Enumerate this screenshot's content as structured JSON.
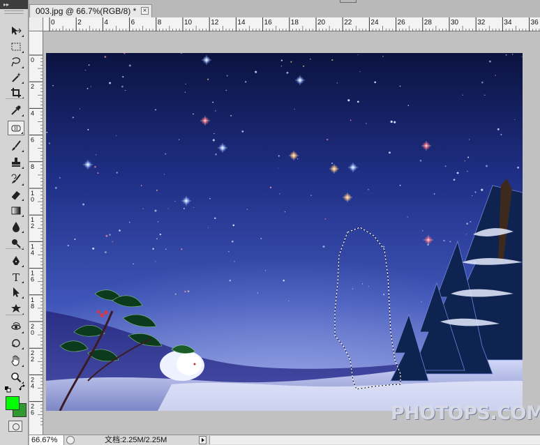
{
  "document": {
    "tab_title": "003.jpg @ 66.7%(RGB/8) *",
    "close_glyph": "×"
  },
  "toolbar": {
    "collapse_glyph": "▸▸",
    "tools": [
      {
        "name": "move-tool-icon"
      },
      {
        "name": "rectangular-marquee-tool-icon"
      },
      {
        "name": "lasso-tool-icon"
      },
      {
        "name": "magic-wand-tool-icon"
      },
      {
        "name": "crop-tool-icon"
      },
      {
        "name": "eyedropper-tool-icon"
      },
      {
        "name": "healing-brush-tool-icon"
      },
      {
        "name": "brush-tool-icon"
      },
      {
        "name": "clone-stamp-tool-icon"
      },
      {
        "name": "history-brush-tool-icon"
      },
      {
        "name": "eraser-tool-icon"
      },
      {
        "name": "gradient-tool-icon"
      },
      {
        "name": "blur-tool-icon"
      },
      {
        "name": "dodge-tool-icon"
      },
      {
        "name": "pen-tool-icon"
      },
      {
        "name": "type-tool-icon"
      },
      {
        "name": "path-selection-tool-icon"
      },
      {
        "name": "custom-shape-tool-icon"
      },
      {
        "name": "3d-rotate-tool-icon"
      },
      {
        "name": "3d-orbit-tool-icon"
      },
      {
        "name": "hand-tool-icon"
      },
      {
        "name": "zoom-tool-icon"
      }
    ],
    "active_tool": "healing-brush-tool-icon",
    "foreground_color": "#00ff00",
    "background_color": "#2f9a2f"
  },
  "rulers": {
    "top_labels": [
      "0",
      "2",
      "4",
      "6",
      "8",
      "10",
      "12",
      "14",
      "16",
      "18",
      "20",
      "22",
      "24",
      "26",
      "28",
      "30",
      "32",
      "34",
      "36"
    ],
    "left_labels": [
      "0",
      "2",
      "4",
      "6",
      "8",
      "10",
      "12",
      "14",
      "16",
      "18",
      "20",
      "22",
      "24",
      "26"
    ]
  },
  "image": {
    "watermark": "PHOTOPS.COM"
  },
  "status": {
    "zoom": "66.67%",
    "doc_info": "文档:2.25M/2.25M"
  }
}
